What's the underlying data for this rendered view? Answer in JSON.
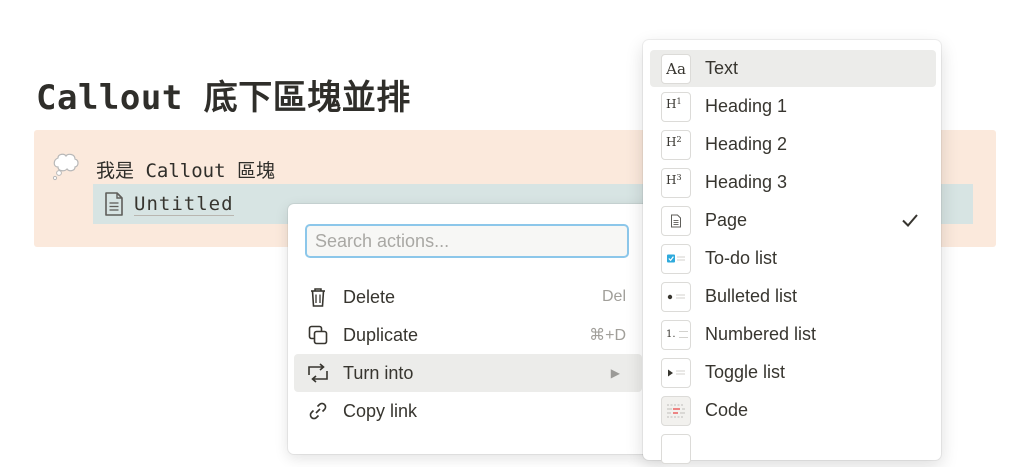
{
  "page": {
    "title": "Callout 底下區塊並排",
    "callout_text": "我是 Callout 區塊",
    "page_link": "Untitled"
  },
  "actions_menu": {
    "search_placeholder": "Search actions...",
    "items": [
      {
        "label": "Delete",
        "shortcut": "Del",
        "icon": "trash-icon"
      },
      {
        "label": "Duplicate",
        "shortcut": "⌘+D",
        "icon": "duplicate-icon"
      },
      {
        "label": "Turn into",
        "shortcut": "",
        "icon": "turn-into-icon",
        "highlighted": true
      },
      {
        "label": "Copy link",
        "shortcut": "",
        "icon": "link-icon"
      }
    ]
  },
  "turn_into_menu": {
    "items": [
      {
        "label": "Text",
        "thumb": "Aa",
        "highlighted": true
      },
      {
        "label": "Heading 1",
        "thumb": "H1"
      },
      {
        "label": "Heading 2",
        "thumb": "H2"
      },
      {
        "label": "Heading 3",
        "thumb": "H3"
      },
      {
        "label": "Page",
        "thumb": "page",
        "checked": true
      },
      {
        "label": "To-do list",
        "thumb": "todo"
      },
      {
        "label": "Bulleted list",
        "thumb": "bullet"
      },
      {
        "label": "Numbered list",
        "thumb": "1."
      },
      {
        "label": "Toggle list",
        "thumb": "toggle"
      },
      {
        "label": "Code",
        "thumb": "code"
      }
    ]
  },
  "colors": {
    "callout_bg": "#fbe9dc",
    "selected_block_bg": "#d7e4e3",
    "search_focus": "#8cc7ea",
    "highlight": "#ececea",
    "todo_blue": "#2eaadc"
  }
}
